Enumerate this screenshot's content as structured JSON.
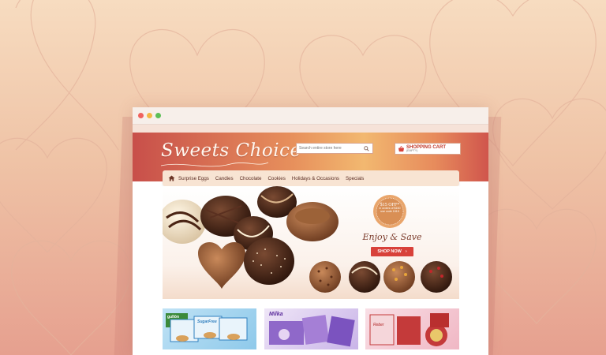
{
  "window": {
    "controls": [
      "close-dot",
      "minimize-dot",
      "maximize-dot"
    ]
  },
  "header": {
    "logo": "Sweets Choice",
    "search_placeholder": "Search entire store here",
    "cart_title": "SHOPPING CART",
    "cart_status": "(EMPTY)"
  },
  "nav": {
    "home_icon": "home-icon",
    "items": [
      "Surprise Eggs",
      "Candies",
      "Chocolate",
      "Cookies",
      "Holidays & Occasions",
      "Specials"
    ]
  },
  "hero": {
    "badge_title": "$15 OFF*",
    "badge_line1": "in orders of $150",
    "badge_line2": "use code 1515",
    "tagline": "Enjoy & Save",
    "shop_button": "SHOP NOW"
  },
  "products": {
    "p1_brand": "gullón",
    "p1_name": "SugarFree",
    "p2_brand": "Milka",
    "p3_brand": "Reber"
  },
  "colors": {
    "accent": "#d8413a",
    "header_left": "#c84f4a",
    "header_mid": "#f2b870",
    "nav_bg": "#f8e4d3",
    "chocolate": "#5a2d23"
  }
}
